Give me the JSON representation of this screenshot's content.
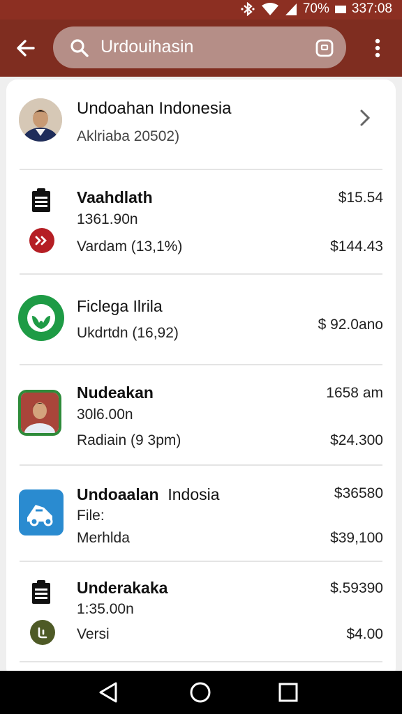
{
  "status_bar": {
    "battery": "70%",
    "time": "337:08"
  },
  "search": {
    "query": "Urdouihasin"
  },
  "account": {
    "name": "Undoahan Indonesia",
    "subtitle": "Aklriaba 20502)"
  },
  "transactions": [
    {
      "title": "Vaahdlath",
      "line1": "1361.90n",
      "line2": "Vardam (13,1%)",
      "amount_top": "$15.54",
      "amount_bottom": "$144.43",
      "icon": "clipboard-icon",
      "sub_icon": "forward-icon"
    },
    {
      "title": "Ficlega Ilrila",
      "line1": "Ukdrtdn (16,92)",
      "amount": "$ 92.0ano",
      "icon": "whatsapp-icon"
    },
    {
      "title": "Nudeakan",
      "line1": "30l6.00n",
      "line2": "Radiain (9 3pm)",
      "amount_top": "1658 am",
      "amount_bottom": "$24.300",
      "icon": "person-avatar"
    },
    {
      "title_bold": "Undoaalan",
      "title_light": "Indosia",
      "line1": "File:",
      "line2": "Merhlda",
      "amount_top": "$36580",
      "amount_bottom": "$39,100",
      "icon": "car-app-icon"
    },
    {
      "title": "Underakaka",
      "line1": "1:35.00n",
      "line2": "Versi",
      "amount_top": "$.59390",
      "amount_bottom": "$4.00",
      "icon": "clipboard-icon",
      "sub_icon": "olive-badge-icon"
    }
  ],
  "colors": {
    "appbar": "#7f2d20",
    "statusbar": "#8c2f22",
    "search_pill": "#b58e87",
    "whatsapp_green": "#1e9b45",
    "forward_red": "#b51e24",
    "app_blue": "#2a8bd0",
    "olive": "#4e5a26"
  }
}
